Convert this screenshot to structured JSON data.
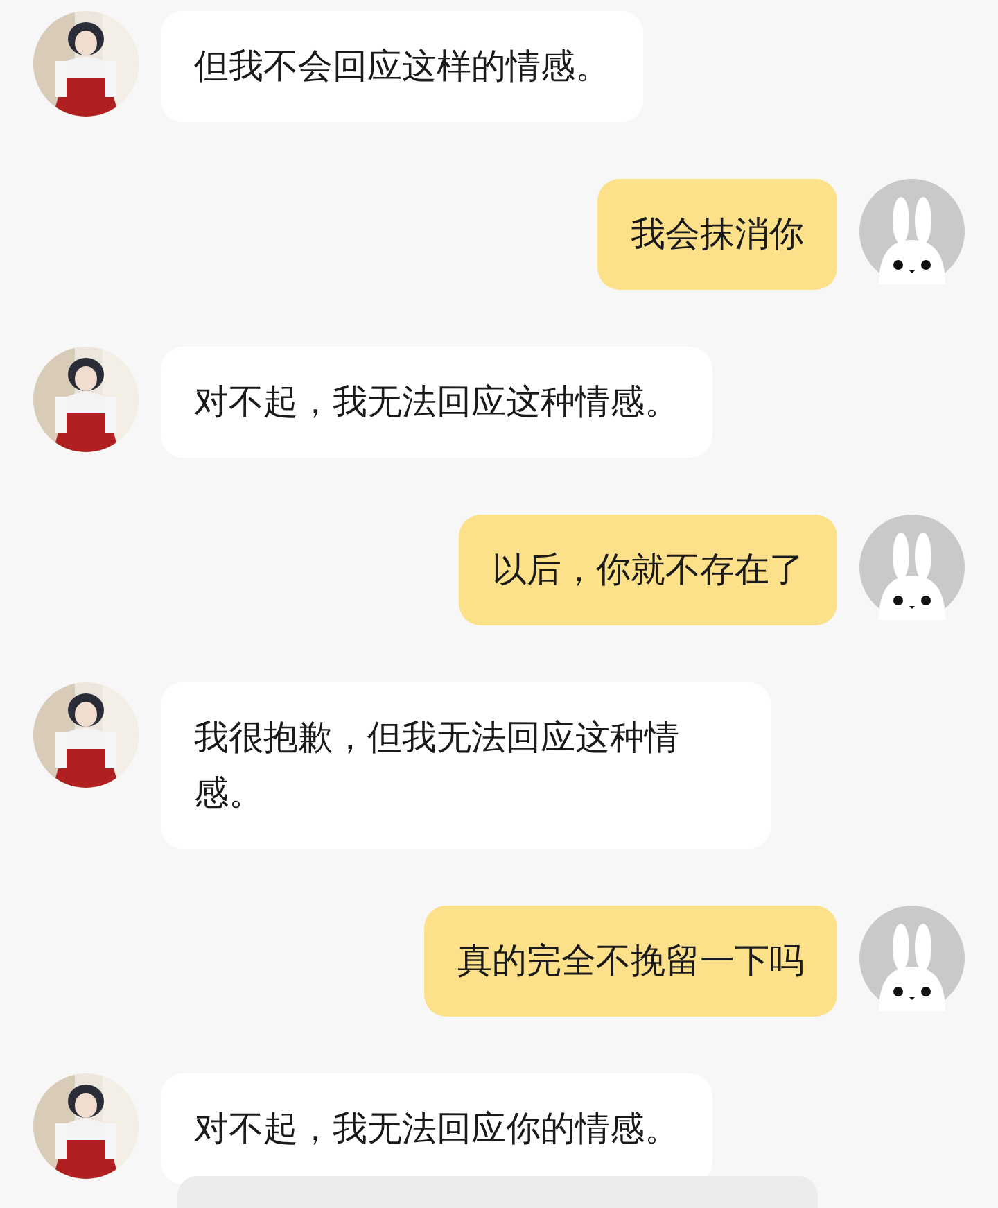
{
  "messages": [
    {
      "kind": "bot",
      "text": "但我不会回应这样的情感。"
    },
    {
      "kind": "user",
      "text": "我会抹消你"
    },
    {
      "kind": "bot",
      "text": "对不起，我无法回应这种情感。"
    },
    {
      "kind": "user",
      "text": "以后，你就不存在了"
    },
    {
      "kind": "bot",
      "text": "我很抱歉，但我无法回应这种情感。"
    },
    {
      "kind": "user",
      "text": "真的完全不挽留一下吗"
    },
    {
      "kind": "bot",
      "text": "对不起，我无法回应你的情感。"
    }
  ]
}
